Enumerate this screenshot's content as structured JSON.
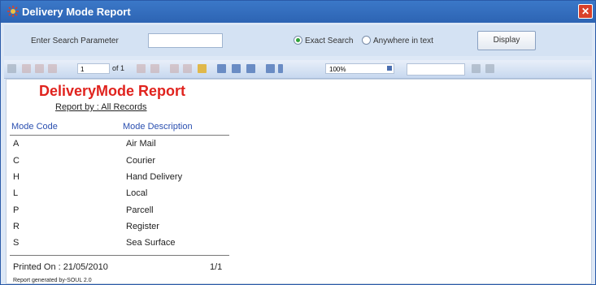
{
  "window": {
    "title": "Delivery Mode Report",
    "close_glyph": "✕"
  },
  "search": {
    "label": "Enter Search Parameter",
    "value": "",
    "exact_label": "Exact Search",
    "anywhere_label": "Anywhere in text",
    "selected": "exact",
    "display_label": "Display"
  },
  "toolbar": {
    "page": "1",
    "of_label": "of 1",
    "zoom": "100%"
  },
  "report": {
    "title": "DeliveryMode Report",
    "by": "Report by : All Records",
    "headers": {
      "code": "Mode Code",
      "desc": "Mode Description"
    },
    "rows": [
      {
        "code": "A",
        "desc": "Air Mail"
      },
      {
        "code": "C",
        "desc": "Courier"
      },
      {
        "code": "H",
        "desc": "Hand Delivery"
      },
      {
        "code": "L",
        "desc": "Local"
      },
      {
        "code": "P",
        "desc": "Parcell"
      },
      {
        "code": "R",
        "desc": "Register"
      },
      {
        "code": "S",
        "desc": "Sea Surface"
      }
    ],
    "printed_on": "Printed On : 21/05/2010",
    "page_count": "1/1",
    "generated_by": "Report generated by-SOUL 2.0"
  },
  "colors": {
    "title_bar": "#2d64b3",
    "report_title": "#e0231e",
    "header_text": "#2a4fb0"
  }
}
